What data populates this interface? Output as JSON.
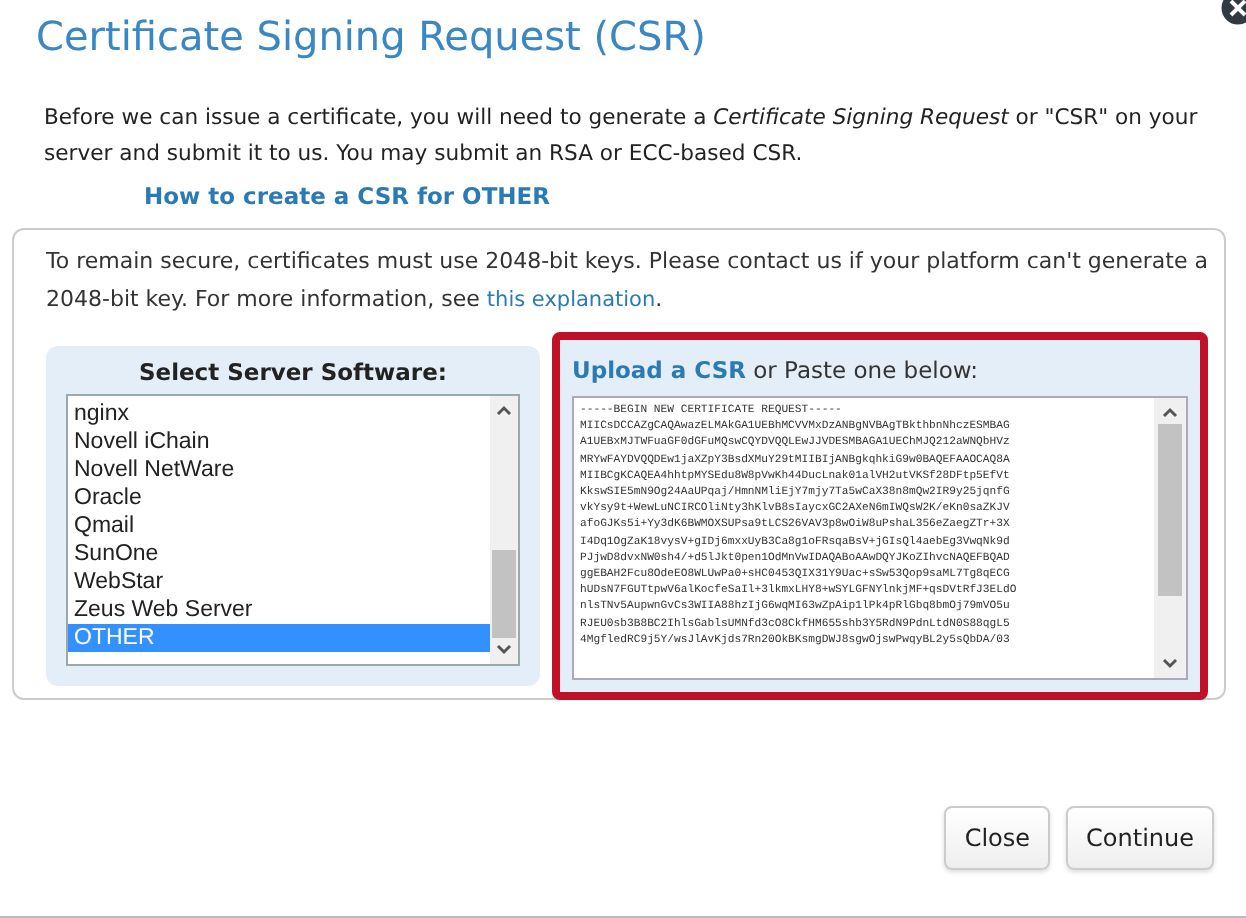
{
  "dialog": {
    "title": "Certificate Signing Request (CSR)"
  },
  "intro": "Before we can issue a certificate, you will need to generate a *Certificate Signing Request* or \"CSR\" on your server and submit it to us. You may submit an RSA or ECC-based CSR.",
  "howto_link": "How to create a CSR for OTHER",
  "notice": {
    "text": "To remain secure, certificates must use 2048-bit keys. Please contact us if your platform can't generate a 2048-bit key. For more information, see",
    "link": "this explanation",
    "end": "."
  },
  "server_software": {
    "heading": "Select Server Software:",
    "items": [
      {
        "label": "nginx",
        "selected": false
      },
      {
        "label": "Novell iChain",
        "selected": false
      },
      {
        "label": "Novell NetWare",
        "selected": false
      },
      {
        "label": "Oracle",
        "selected": false
      },
      {
        "label": "Qmail",
        "selected": false
      },
      {
        "label": "SunOne",
        "selected": false
      },
      {
        "label": "WebStar",
        "selected": false
      },
      {
        "label": "Zeus Web Server",
        "selected": false
      },
      {
        "label": "OTHER",
        "selected": true
      }
    ]
  },
  "csr": {
    "upload_link": "Upload a CSR",
    "label": "or Paste one below:",
    "value": "-----BEGIN NEW CERTIFICATE REQUEST-----\nMIICsDCCAZgCAQAwazELMAkGA1UEBhMCVVMxDzANBgNVBAgTBkthbnNhczESMBAG\nA1UEBxMJTWFuaGF0dGFuMQswCQYDVQQLEwJJVDESMBAGA1UEChMJQ212aWNQbHVz\nMRYwFAYDVQQDEw1jaXZpY3BsdXMuY29tMIIBIjANBgkqhkiG9w0BAQEFAAOCAQ8A\nMIIBCgKCAQEA4hhtpMYSEdu8W8pVwKh44DucLnak01alVH2utVKSf28DFtp5EfVt\nKkswSIE5mN9Og24AaUPqaj/HmnNMliEjY7mjy7Ta5wCaX38n8mQw2IR9y25jqnfG\nvkYsy9t+WewLuNCIRCOliNty3hKlvB8sIaycxGC2AXeN6mIWQsW2K/eKn0saZKJV\nafoGJKs5i+Yy3dK6BWMOXSUPsa9tLCS26VAV3p8wOiW8uPshaL356eZaegZTr+3X\nI4Dq1OgZaK18vysV+gIDj6mxxUyB3Ca8g1oFRsqaBsV+jGIsQl4aebEg3VwqNk9d\nPJjwD8dvxNW0sh4/+d5lJkt0pen1OdMnVwIDAQABoAAwDQYJKoZIhvcNAQEFBQAD\nggEBAH2Fcu8OdeEO8WLUwPa0+sHC0453QIX31Y9Uac+sSw53Qop9saML7Tg8qECG\nhUDsN7FGUTtpwV6alKocfeSaIl+3lkmxLHY8+wSYLGFNYlnkjMF+qsDVtRfJ3ELdO\nnlsTNv5AupwnGvCs3WIIA88hzIjG6wqMI63wZpAip1lPk4pRlGbq8bmOj79mVO5u\nRJEU0sb3B8BC2IhlsGablsUMNfd3cO8CkfHM655shb3Y5RdN9PdnLtdN0S88qgL5\n4MgfledRC9j5Y/wsJlAvKjds7Rn20OkBKsmgDWJ8sgwOjswPwqyBL2y5sQbDA/03"
  },
  "buttons": [
    "Close",
    "Continue"
  ]
}
